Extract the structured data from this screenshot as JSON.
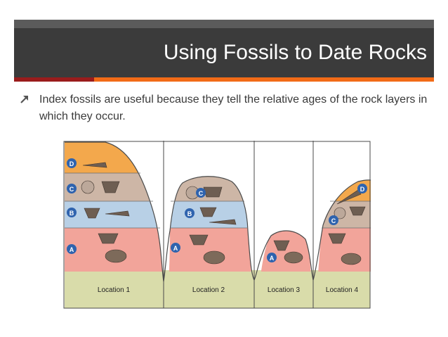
{
  "slide": {
    "title": "Using Fossils to Date Rocks",
    "bullet": "Index fossils are useful because they tell the relative ages of the rock layers in which they occur.",
    "bullet_icon": "arrow-up-right-icon"
  },
  "figure": {
    "locations": [
      "Location 1",
      "Location 2",
      "Location 3",
      "Location 4"
    ],
    "layer_labels": [
      "A",
      "B",
      "C",
      "D"
    ],
    "colors": {
      "ground": "#d9dcaa",
      "layer_a": "#f2a49a",
      "layer_b": "#b8d0e6",
      "layer_c": "#cdb6a6",
      "layer_d": "#f3a84c",
      "badge": "#2f63ae"
    }
  }
}
